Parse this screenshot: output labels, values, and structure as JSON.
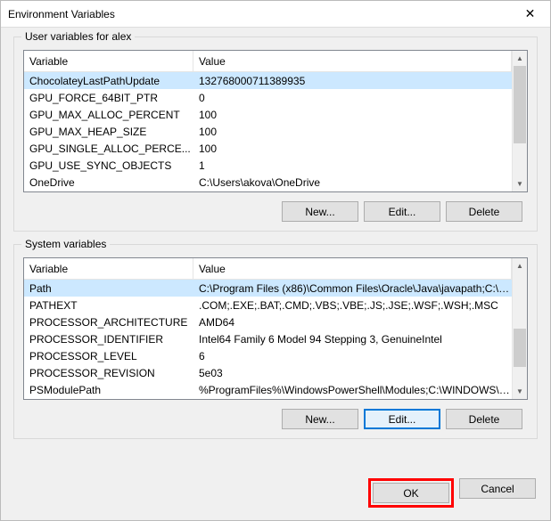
{
  "window": {
    "title": "Environment Variables"
  },
  "user_section": {
    "legend": "User variables for alex",
    "columns": {
      "var": "Variable",
      "val": "Value"
    },
    "rows": [
      {
        "var": "ChocolateyLastPathUpdate",
        "val": "132768000711389935",
        "selected": true
      },
      {
        "var": "GPU_FORCE_64BIT_PTR",
        "val": "0"
      },
      {
        "var": "GPU_MAX_ALLOC_PERCENT",
        "val": "100"
      },
      {
        "var": "GPU_MAX_HEAP_SIZE",
        "val": "100"
      },
      {
        "var": "GPU_SINGLE_ALLOC_PERCE...",
        "val": "100"
      },
      {
        "var": "GPU_USE_SYNC_OBJECTS",
        "val": "1"
      },
      {
        "var": "OneDrive",
        "val": "C:\\Users\\akova\\OneDrive"
      }
    ],
    "buttons": {
      "new": "New...",
      "edit": "Edit...",
      "delete": "Delete"
    }
  },
  "system_section": {
    "legend": "System variables",
    "columns": {
      "var": "Variable",
      "val": "Value"
    },
    "rows": [
      {
        "var": "Path",
        "val": "C:\\Program Files (x86)\\Common Files\\Oracle\\Java\\javapath;C:\\Pro...",
        "selected": true
      },
      {
        "var": "PATHEXT",
        "val": ".COM;.EXE;.BAT;.CMD;.VBS;.VBE;.JS;.JSE;.WSF;.WSH;.MSC"
      },
      {
        "var": "PROCESSOR_ARCHITECTURE",
        "val": "AMD64"
      },
      {
        "var": "PROCESSOR_IDENTIFIER",
        "val": "Intel64 Family 6 Model 94 Stepping 3, GenuineIntel"
      },
      {
        "var": "PROCESSOR_LEVEL",
        "val": "6"
      },
      {
        "var": "PROCESSOR_REVISION",
        "val": "5e03"
      },
      {
        "var": "PSModulePath",
        "val": "%ProgramFiles%\\WindowsPowerShell\\Modules;C:\\WINDOWS\\syst..."
      }
    ],
    "buttons": {
      "new": "New...",
      "edit": "Edit...",
      "delete": "Delete"
    }
  },
  "dialog_buttons": {
    "ok": "OK",
    "cancel": "Cancel"
  }
}
